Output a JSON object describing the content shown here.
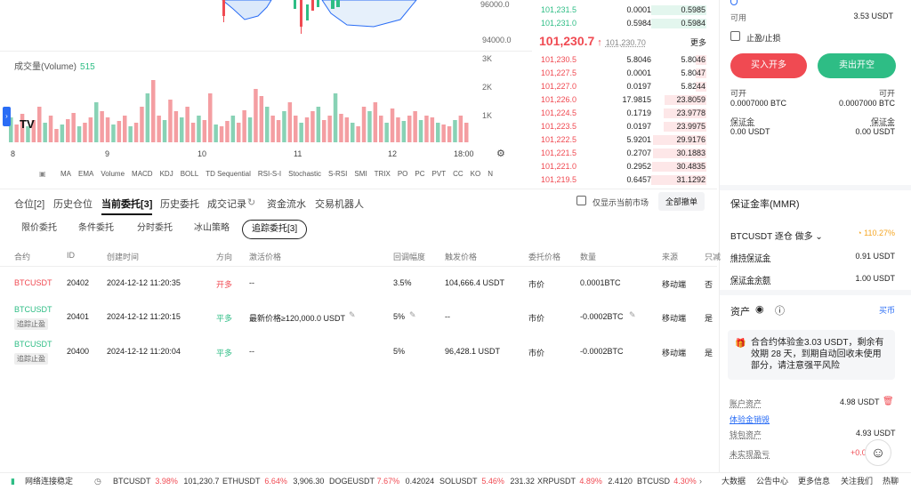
{
  "chart": {
    "price_axis": [
      "96000.0",
      "94000.0"
    ],
    "volume_label": "成交量(Volume)",
    "volume_value": "515",
    "volume_axis": [
      "3K",
      "2K",
      "1K"
    ],
    "time_axis": [
      "8",
      "9",
      "10",
      "11",
      "12",
      "18:00"
    ],
    "indicators": [
      "MA",
      "EMA",
      "Volume",
      "MACD",
      "KDJ",
      "BOLL",
      "TD Sequential",
      "RSI-S-I",
      "Stochastic",
      "S-RSI",
      "SMI",
      "TRIX",
      "PO",
      "PC",
      "PVT",
      "CC",
      "KO",
      "N"
    ],
    "tv_logo": "TV"
  },
  "orderbook": {
    "asks_top": [
      {
        "p": "101,231.5",
        "q": "0.0001",
        "t": "0.5985"
      },
      {
        "p": "101,231.0",
        "q": "0.5984",
        "t": "0.5984"
      }
    ],
    "mid_price": "101,230.7",
    "mark_price": "101,230.70",
    "more": "更多",
    "bids": [
      {
        "p": "101,230.5",
        "q": "5.8046",
        "t": "5.8046"
      },
      {
        "p": "101,227.5",
        "q": "0.0001",
        "t": "5.8047"
      },
      {
        "p": "101,227.0",
        "q": "0.0197",
        "t": "5.8244"
      },
      {
        "p": "101,226.0",
        "q": "17.9815",
        "t": "23.8059"
      },
      {
        "p": "101,224.5",
        "q": "0.1719",
        "t": "23.9778"
      },
      {
        "p": "101,223.5",
        "q": "0.0197",
        "t": "23.9975"
      },
      {
        "p": "101,222.5",
        "q": "5.9201",
        "t": "29.9176"
      },
      {
        "p": "101,221.5",
        "q": "0.2707",
        "t": "30.1883"
      },
      {
        "p": "101,221.0",
        "q": "0.2952",
        "t": "30.4835"
      },
      {
        "p": "101,219.5",
        "q": "0.6457",
        "t": "31.1292"
      }
    ]
  },
  "trade": {
    "available_label": "可用",
    "available_value": "3.53 USDT",
    "tpsl_label": "止盈/止损",
    "buy_label": "买入开多",
    "sell_label": "卖出开空",
    "can_open_label": "可开",
    "can_open_left": "0.0007000 BTC",
    "can_open_right": "0.0007000 BTC",
    "margin_label": "保证金",
    "margin_left": "0.00 USDT",
    "margin_right": "0.00 USDT"
  },
  "mmr": {
    "title": "保证金率(MMR)",
    "pair": "BTCUSDT 逐仓 做多",
    "ratio": "110.27%",
    "maint_label": "维持保证金",
    "maint_value": "0.91 USDT",
    "bal_label": "保证金余额",
    "bal_value": "1.00 USDT",
    "assets_label": "资产",
    "buy_coin": "买币",
    "card_text": "合合约体验金3.03 USDT，剩余有效期 28 天，到期自动回收未使用部分，请注意强平风险",
    "acct_label": "账户资产",
    "acct_value": "4.98 USDT",
    "trial_link": "体验金销毁",
    "wallet_label": "钱包资产",
    "wallet_value": "4.93 USDT",
    "unreal_label": "未实现盈亏",
    "unreal_value": "+0.0"
  },
  "tabs": [
    "仓位[2]",
    "历史仓位",
    "当前委托[3]",
    "历史委托",
    "成交记录",
    "资金流水",
    "交易机器人"
  ],
  "only_current_label": "仅显示当前市场",
  "cancel_all": "全部撤单",
  "subtabs": [
    "限价委托",
    "条件委托",
    "分时委托",
    "冰山策略",
    "追踪委托[3]"
  ],
  "table": {
    "headers": [
      "合约",
      "ID",
      "创建时间",
      "方向",
      "激活价格",
      "回调幅度",
      "触发价格",
      "委托价格",
      "数量",
      "来源",
      "只减"
    ],
    "rows": [
      {
        "symbol": "BTCUSDT",
        "tag": "",
        "id": "20402",
        "time": "2024-12-12 11:20:35",
        "dir": "开多",
        "act": "--",
        "cb": "3.5%",
        "trig": "104,666.4 USDT",
        "ord": "市价",
        "qty": "0.0001BTC",
        "src": "移动端",
        "ro": "否"
      },
      {
        "symbol": "BTCUSDT",
        "tag": "追踪止盈",
        "id": "20401",
        "time": "2024-12-12 11:20:15",
        "dir": "平多",
        "act": "最新价格≥120,000.0 USDT",
        "cb": "5%",
        "trig": "--",
        "ord": "市价",
        "qty": "-0.0002BTC",
        "src": "移动端",
        "ro": "是"
      },
      {
        "symbol": "BTCUSDT",
        "tag": "追踪止盈",
        "id": "20400",
        "time": "2024-12-12 11:20:04",
        "dir": "平多",
        "act": "--",
        "cb": "5%",
        "trig": "96,428.1 USDT",
        "ord": "市价",
        "qty": "-0.0002BTC",
        "src": "移动端",
        "ro": "是"
      }
    ]
  },
  "status": {
    "network": "网络连接稳定",
    "tickers": [
      {
        "s": "BTCUSDT",
        "c": "3.98%",
        "p": "101,230.7"
      },
      {
        "s": "ETHUSDT",
        "c": "6.64%",
        "p": "3,906.30"
      },
      {
        "s": "DOGEUSDT",
        "c": "7.67%",
        "p": "0.42024"
      },
      {
        "s": "SOLUSDT",
        "c": "5.46%",
        "p": "231.32"
      },
      {
        "s": "XRPUSDT",
        "c": "4.89%",
        "p": "2.4120"
      },
      {
        "s": "BTCUSD",
        "c": "4.30%",
        "p": ""
      }
    ],
    "links": [
      "大数据",
      "公告中心",
      "更多信息",
      "关注我们",
      "热聊"
    ]
  }
}
